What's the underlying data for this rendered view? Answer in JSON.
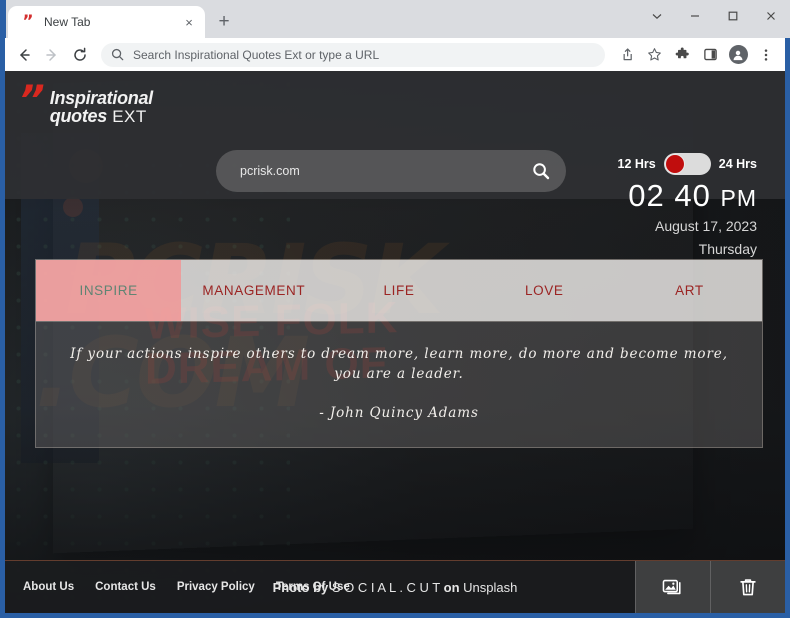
{
  "browser": {
    "tab": {
      "title": "New Tab",
      "favicon": "quote-mark-favicon",
      "close_label": "×"
    },
    "new_tab_label": "+",
    "window_controls": {
      "chevron": "⌄",
      "minimize": "—",
      "maximize": "□",
      "close": "✕"
    },
    "nav": {
      "back": "back-arrow",
      "forward": "forward-arrow",
      "reload": "reload"
    },
    "omnibox": {
      "value": "",
      "placeholder": "Search Inspirational Quotes Ext or type a URL",
      "text": "Search Inspirational Quotes Ext or type a URL"
    },
    "actions": [
      "share-icon",
      "bookmark-star-icon",
      "extensions-puzzle-icon",
      "side-panel-icon",
      "profile-avatar-icon",
      "chrome-menu-icon"
    ]
  },
  "extension": {
    "logo": {
      "quote_mark": "”",
      "line1": "Inspirational",
      "line2": "quotes",
      "suffix": " EXT"
    },
    "search": {
      "value": "pcrisk.com",
      "placeholder": "pcrisk.com",
      "icon": "search-icon"
    },
    "clock": {
      "toggle_left_label": "12 Hrs",
      "toggle_right_label": "24 Hrs",
      "toggle_state": "12-hour",
      "hours": "02",
      "minutes": "40",
      "meridiem": "PM",
      "date": "August 17, 2023",
      "weekday": "Thursday"
    },
    "tabs": [
      {
        "label": "INSPIRE",
        "active": true
      },
      {
        "label": "MANAGEMENT",
        "active": false
      },
      {
        "label": "LIFE",
        "active": false
      },
      {
        "label": "LOVE",
        "active": false
      },
      {
        "label": "ART",
        "active": false
      }
    ],
    "quote": {
      "text": "If your actions inspire others to dream more, learn more, do more and become more, you are a leader.",
      "author": "- John Quincy Adams"
    },
    "footer": {
      "links": [
        "About Us",
        "Contact Us",
        "Privacy Policy",
        "Terms Of Use"
      ],
      "credit_prefix": "Photo",
      "credit_by": "by",
      "credit_author": "S O C I A L . C U T",
      "credit_on": "on",
      "credit_source": "Unsplash",
      "buttons": [
        "change-wallpaper-icon",
        "delete-icon"
      ]
    },
    "background": {
      "watermark_line1": "PCRISK",
      "watermark_line2": ".COM",
      "poster_line1": "WISE FOLK",
      "poster_line2": "DREAM OF"
    }
  },
  "colors": {
    "accent_red": "#d9281f",
    "tab_red": "#9b2423",
    "active_tab_bg": "#f68d8d",
    "toggle_knob": "#c00d0d",
    "window_frame": "#2a5fa5"
  }
}
